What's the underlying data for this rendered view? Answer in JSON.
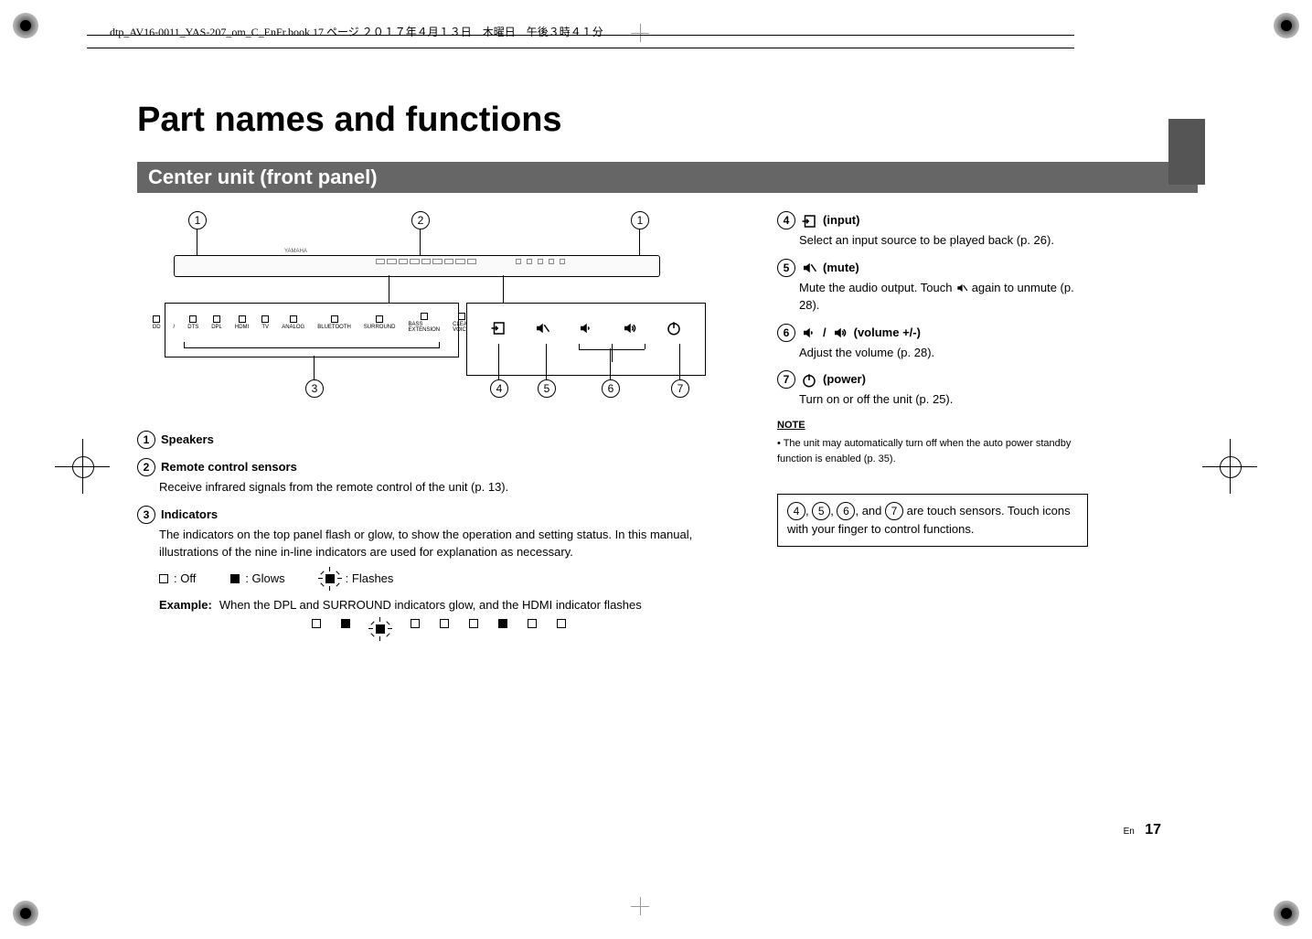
{
  "header_text": "dtp_AV16-0011_YAS-207_om_C_EnFr.book  17 ページ  ２０１７年４月１３日　木曜日　午後３時４１分",
  "title": "Part names and functions",
  "section_title": "Center unit (front panel)",
  "callouts": {
    "c1": "1",
    "c2": "2",
    "c3": "3",
    "c4": "4",
    "c5": "5",
    "c6": "6",
    "c7": "7"
  },
  "indicators": [
    "DD",
    "/",
    "DTS",
    "DPL",
    "HDMI",
    "TV",
    "ANALOG",
    "BLUETOOTH",
    "SURROUND",
    "BASS EXTENSION",
    "CLEAR VOICE"
  ],
  "left": {
    "item1_head": "Speakers",
    "item2_head": "Remote control sensors",
    "item2_body": "Receive infrared signals from the remote control of the unit (p. 13).",
    "item3_head": "Indicators",
    "item3_body": "The indicators on the top panel flash or glow, to show the operation and setting status. In this manual, illustrations of the nine in-line indicators are used for explanation as necessary.",
    "legend_off": ": Off",
    "legend_glows": ": Glows",
    "legend_flashes": ": Flashes",
    "example_label": "Example:",
    "example_text": "When the DPL and SURROUND indicators glow, and the HDMI indicator flashes"
  },
  "right": {
    "item4_head": " (input)",
    "item4_body": "Select an input source to be played back (p. 26).",
    "item5_head": " (mute)",
    "item5_body_a": "Mute the audio output. Touch ",
    "item5_body_b": " again to unmute (p. 28).",
    "item6_head": " (volume +/-)",
    "item6_body": "Adjust the volume (p. 28).",
    "item7_head": " (power)",
    "item7_body": "Turn on or off the unit (p. 25).",
    "note_head": "NOTE",
    "note_body": "• The unit may automatically turn off when the auto power standby function is enabled (p. 35).",
    "touch_note_a": ", ",
    "touch_note_b": ", ",
    "touch_note_c": ", and ",
    "touch_note_d": " are touch sensors. Touch icons with your finger to control functions."
  },
  "footer_lang": "En",
  "footer_page": "17"
}
